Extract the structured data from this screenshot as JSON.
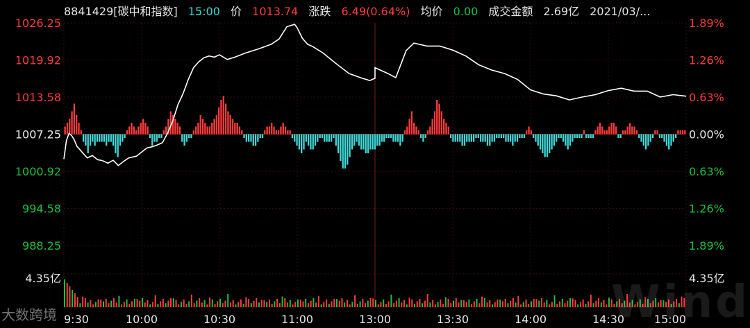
{
  "header": {
    "code_name": "8841429[碳中和指数]",
    "time": "15:00",
    "price_label": "价",
    "price": "1013.74",
    "change_label": "涨跌",
    "change": "6.49(0.64%)",
    "avg_label": "均价",
    "avg": "0.00",
    "amount_label": "成交金额",
    "amount": "2.69亿",
    "date": "2021/03/..."
  },
  "watermark": "Wind",
  "brand": "大数跨境",
  "colors": {
    "up": "#ff3b3b",
    "down": "#3fd9d9",
    "green": "#19c23a",
    "line": "#ffffff",
    "grid": "#3a0b0b",
    "background": "#000000"
  },
  "chart_data": [
    {
      "type": "line",
      "title": "",
      "xlabel": "",
      "ylabel": "",
      "prev_close": 1007.25,
      "ylim": [
        988.25,
        1026.25
      ],
      "y_ticks": [
        "1026.25",
        "1019.92",
        "1013.58",
        "1007.25",
        "1000.92",
        "994.58",
        "988.25"
      ],
      "y_ticks_right": [
        "1.89%",
        "1.26%",
        "0.63%",
        "0.00%",
        "0.63%",
        "1.26%",
        "1.89%"
      ],
      "x_ticks": [
        "9:30",
        "10:00",
        "10:30",
        "11:00",
        "13:00",
        "13:30",
        "14:00",
        "14:30",
        "15:00"
      ],
      "series": [
        {
          "x": [
            "9:30",
            "9:31",
            "9:32",
            "9:33",
            "9:34",
            "9:35",
            "9:37",
            "9:39",
            "9:41",
            "9:43",
            "9:45",
            "9:47",
            "9:49",
            "9:51",
            "9:53",
            "9:55",
            "9:58",
            "10:00",
            "10:02",
            "10:04",
            "10:06",
            "10:08",
            "10:10",
            "10:12",
            "10:14",
            "10:16",
            "10:18",
            "10:20",
            "10:22",
            "10:24",
            "10:26",
            "10:28",
            "10:30",
            "10:33",
            "10:36",
            "10:40",
            "10:45",
            "10:50",
            "10:53",
            "10:56",
            "10:59",
            "11:00",
            "11:02",
            "11:04",
            "11:06",
            "11:10",
            "11:15",
            "11:20",
            "11:25",
            "11:28",
            "11:30",
            "13:00",
            "13:02",
            "13:05",
            "13:08",
            "13:12",
            "13:15",
            "13:20",
            "13:25",
            "13:30",
            "13:35",
            "13:40",
            "13:45",
            "13:50",
            "13:55",
            "14:00",
            "14:05",
            "14:10",
            "14:15",
            "14:20",
            "14:25",
            "14:30",
            "14:35",
            "14:40",
            "14:45",
            "14:50",
            "14:55",
            "15:00"
          ],
          "values": [
            1003.0,
            1006.2,
            1007.4,
            1007.0,
            1006.3,
            1005.2,
            1004.2,
            1003.2,
            1003.6,
            1002.9,
            1002.7,
            1002.3,
            1002.8,
            1001.9,
            1002.6,
            1003.2,
            1003.5,
            1004.2,
            1004.9,
            1005.1,
            1005.4,
            1005.8,
            1007.4,
            1009.5,
            1012.3,
            1014.2,
            1016.6,
            1018.6,
            1019.6,
            1020.3,
            1020.6,
            1020.4,
            1020.8,
            1020.0,
            1020.4,
            1021.1,
            1021.8,
            1022.6,
            1023.5,
            1025.6,
            1026.0,
            1025.4,
            1023.6,
            1022.6,
            1022.2,
            1021.1,
            1019.3,
            1017.6,
            1016.8,
            1016.4,
            1016.8,
            1018.6,
            1018.2,
            1017.6,
            1016.9,
            1021.5,
            1022.8,
            1022.3,
            1022.3,
            1021.6,
            1020.6,
            1019.1,
            1018.2,
            1017.6,
            1016.6,
            1014.8,
            1014.1,
            1013.8,
            1013.1,
            1013.6,
            1014.0,
            1014.7,
            1015.1,
            1014.6,
            1014.6,
            1013.6,
            1014.0,
            1013.74
          ]
        }
      ]
    },
    {
      "type": "bar",
      "title": "",
      "note": "intraday net-strength bars around zero line",
      "values": [
        2,
        3,
        4,
        6,
        8,
        5,
        3,
        1,
        -2,
        -3,
        -5,
        -3,
        -2,
        -3,
        -2,
        -2,
        -2,
        -2,
        -3,
        -2,
        -2,
        -3,
        -5,
        -6,
        -3,
        -2,
        -1,
        1,
        2,
        3,
        2,
        1,
        2,
        3,
        4,
        3,
        2,
        -1,
        -3,
        -2,
        -2,
        -1,
        -1,
        1,
        2,
        4,
        6,
        5,
        4,
        3,
        2,
        -2,
        -3,
        -2,
        -1,
        -1,
        1,
        2,
        3,
        5,
        4,
        3,
        2,
        2,
        3,
        4,
        5,
        7,
        9,
        10,
        8,
        6,
        5,
        4,
        3,
        3,
        2,
        1,
        -1,
        -2,
        -2,
        -2,
        -3,
        -3,
        -2,
        -1,
        -1,
        1,
        2,
        2,
        3,
        2,
        1,
        1,
        2,
        3,
        2,
        1,
        1,
        -1,
        -2,
        -3,
        -4,
        -5,
        -4,
        -2,
        -3,
        -4,
        -4,
        -3,
        -2,
        -1,
        -1,
        -2,
        -2,
        -2,
        -2,
        -1,
        -3,
        -5,
        -7,
        -9,
        -9,
        -8,
        -6,
        -4,
        -3,
        -2,
        -3,
        -4,
        -4,
        -5,
        -5,
        -4,
        -4,
        -4,
        -3,
        -3,
        -2,
        -2,
        -1,
        -1,
        -1,
        -2,
        -2,
        -2,
        -3,
        -2,
        1,
        2,
        4,
        6,
        3,
        2,
        1,
        -1,
        -2,
        -1,
        1,
        2,
        4,
        6,
        9,
        8,
        6,
        4,
        3,
        2,
        -1,
        -2,
        -2,
        -2,
        -2,
        -3,
        -3,
        -2,
        -2,
        -2,
        -2,
        -1,
        -1,
        -2,
        -2,
        -2,
        -3,
        -3,
        -2,
        -2,
        -1,
        -1,
        -1,
        -1,
        -2,
        -2,
        -2,
        -3,
        -2,
        -2,
        -1,
        -1,
        -1,
        1,
        2,
        1,
        -1,
        -2,
        -3,
        -4,
        -5,
        -6,
        -6,
        -5,
        -4,
        -3,
        -2,
        -1,
        -1,
        -2,
        -3,
        -4,
        -3,
        -2,
        -1,
        -1,
        -1,
        -1,
        1,
        -1,
        -1,
        -1,
        -1,
        1,
        2,
        3,
        2,
        1,
        1,
        2,
        3,
        3,
        2,
        -1,
        -1,
        1,
        1,
        2,
        3,
        2,
        2,
        1,
        -1,
        -2,
        -3,
        -4,
        -3,
        -2,
        -1,
        1,
        1,
        -1,
        -1,
        -2,
        -3,
        -4,
        -3,
        -2,
        -1,
        1,
        1,
        1,
        1
      ]
    },
    {
      "type": "bar",
      "title": "",
      "ylabel": "",
      "ylim_label": "4.35亿",
      "note": "volume bars"
    }
  ]
}
